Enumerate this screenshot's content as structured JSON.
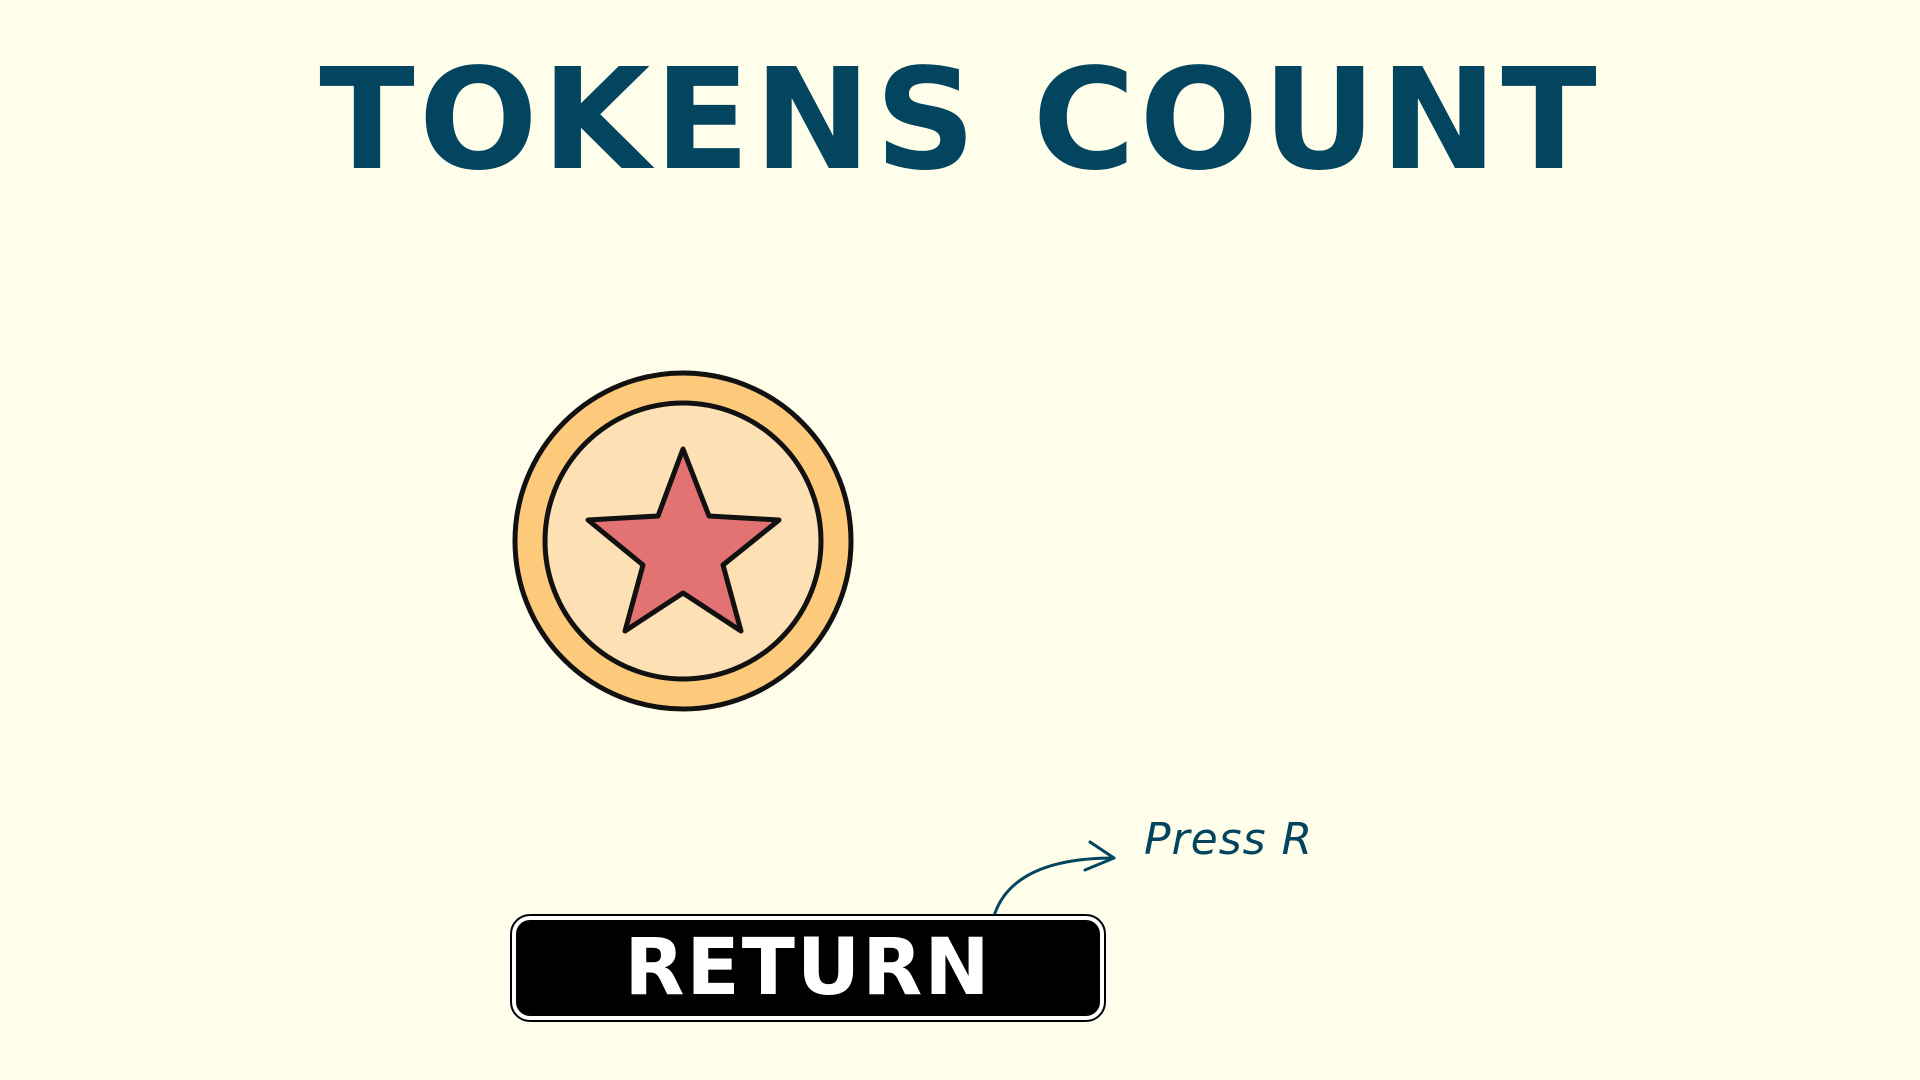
{
  "screen": {
    "title": "TOKENS COUNT"
  },
  "token": {
    "icon": "star-coin-icon",
    "colors": {
      "outer_ring": "#fdca7c",
      "inner_face": "#fde0b3",
      "star": "#e37373",
      "outline": "#111111"
    }
  },
  "return_button": {
    "label": "RETURN",
    "hint": "Press R"
  },
  "colors": {
    "background": "#fefeeb",
    "title": "#03445e",
    "button_bg": "#000000",
    "button_text": "#ffffff"
  }
}
